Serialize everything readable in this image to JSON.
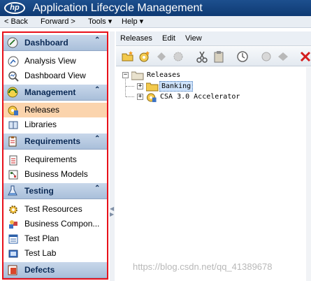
{
  "app": {
    "logo_text": "hp",
    "title": "Application Lifecycle Management"
  },
  "menubar": {
    "back": "< Back",
    "forward": "Forward >",
    "tools": "Tools ▾",
    "help": "Help ▾"
  },
  "sidebar": {
    "sections": [
      {
        "label": "Dashboard",
        "collapse": "⌃",
        "items": [
          "Analysis View",
          "Dashboard View"
        ]
      },
      {
        "label": "Management",
        "collapse": "⌃",
        "items": [
          "Releases",
          "Libraries"
        ],
        "selected": "Releases"
      },
      {
        "label": "Requirements",
        "collapse": "⌃",
        "items": [
          "Requirements",
          "Business Models"
        ]
      },
      {
        "label": "Testing",
        "collapse": "⌃",
        "items": [
          "Test Resources",
          "Business Compon...",
          "Test Plan",
          "Test Lab"
        ]
      },
      {
        "label": "Defects"
      }
    ]
  },
  "main": {
    "menu": [
      "Releases",
      "Edit",
      "View"
    ],
    "tree": {
      "root": "Releases",
      "children": [
        "Banking",
        "CSA 3.0 Accelerator"
      ],
      "selected": "Banking"
    }
  },
  "watermark": "https://blog.csdn.net/qq_41389678",
  "colors": {
    "titlebar": "#1d4f8e",
    "sidebar_highlight_border": "#e8101a",
    "selected_item": "#fbd4ad"
  }
}
